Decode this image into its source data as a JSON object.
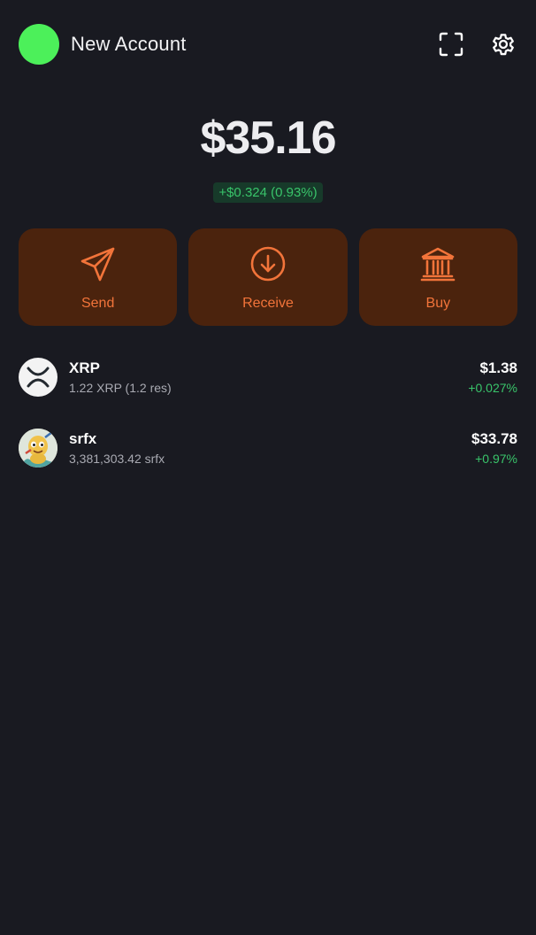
{
  "header": {
    "account_name": "New Account",
    "avatar_color": "#4cf05a",
    "scan_icon": "scan-icon",
    "settings_icon": "gear-icon"
  },
  "balance": {
    "total": "$35.16",
    "change": "+$0.324 (0.93%)",
    "change_color": "#39c46a"
  },
  "actions": [
    {
      "label": "Send",
      "icon": "send-icon"
    },
    {
      "label": "Receive",
      "icon": "download-circle-icon"
    },
    {
      "label": "Buy",
      "icon": "bank-icon"
    }
  ],
  "accent_color": "#f2743a",
  "assets": [
    {
      "name": "XRP",
      "amount": "1.22 XRP (1.2 res)",
      "value": "$1.38",
      "change": "+0.027%",
      "icon": "xrp-logo-icon"
    },
    {
      "name": "srfx",
      "amount": "3,381,303.42 srfx",
      "value": "$33.78",
      "change": "+0.97%",
      "icon": "srfx-logo-icon"
    }
  ]
}
